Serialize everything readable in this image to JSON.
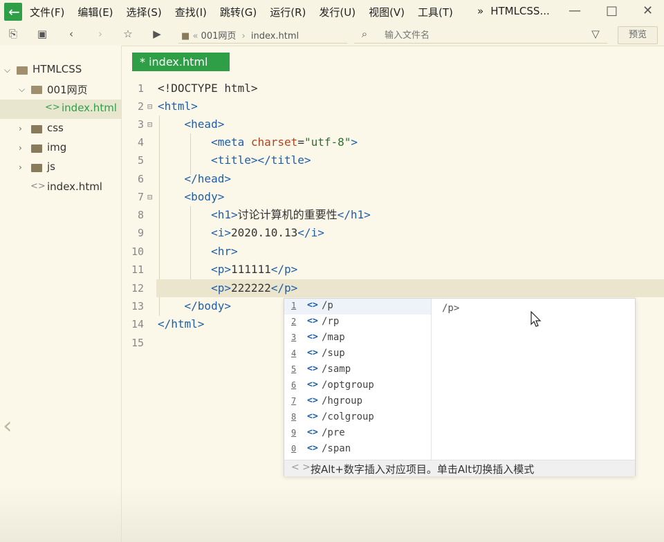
{
  "menubar": {
    "items": [
      "文件(F)",
      "编辑(E)",
      "选择(S)",
      "查找(I)",
      "跳转(G)",
      "运行(R)",
      "发行(U)",
      "视图(V)",
      "工具(T)"
    ],
    "window_title": "HTMLCSS..."
  },
  "toolbar": {
    "breadcrumb": [
      "001网页",
      "index.html"
    ],
    "file_search_placeholder": "输入文件名",
    "preview_label": "预览"
  },
  "sidebar": {
    "tree": [
      {
        "label": "HTMLCSS",
        "type": "project",
        "expanded": true
      },
      {
        "label": "001网页",
        "type": "folder",
        "expanded": true
      },
      {
        "label": "index.html",
        "type": "file",
        "selected": true
      },
      {
        "label": "css",
        "type": "folder",
        "expanded": false
      },
      {
        "label": "img",
        "type": "folder",
        "expanded": false
      },
      {
        "label": "js",
        "type": "folder",
        "expanded": false
      },
      {
        "label": "index.html",
        "type": "file",
        "selected": false
      }
    ]
  },
  "editor": {
    "tab_label": "* index.html",
    "line_numbers": [
      "1",
      "2",
      "3",
      "4",
      "5",
      "6",
      "7",
      "8",
      "9",
      "10",
      "11",
      "12",
      "13",
      "14",
      "15"
    ],
    "current_line": 12
  },
  "autocomplete": {
    "items": [
      {
        "num": "1",
        "label": "/p"
      },
      {
        "num": "2",
        "label": "/rp"
      },
      {
        "num": "3",
        "label": "/map"
      },
      {
        "num": "4",
        "label": "/sup"
      },
      {
        "num": "5",
        "label": "/samp"
      },
      {
        "num": "6",
        "label": "/optgroup"
      },
      {
        "num": "7",
        "label": "/hgroup"
      },
      {
        "num": "8",
        "label": "/colgroup"
      },
      {
        "num": "9",
        "label": "/pre"
      },
      {
        "num": "0",
        "label": "/span"
      }
    ],
    "detail": "/p>",
    "footer_hint": "按Alt+数字插入对应项目。单击Alt切换插入模式"
  },
  "colors": {
    "accent": "#2e9e47",
    "tag": "#1d5ea8",
    "attr": "#b5411b",
    "string": "#2d6e2e",
    "background": "#fbf8ea"
  }
}
